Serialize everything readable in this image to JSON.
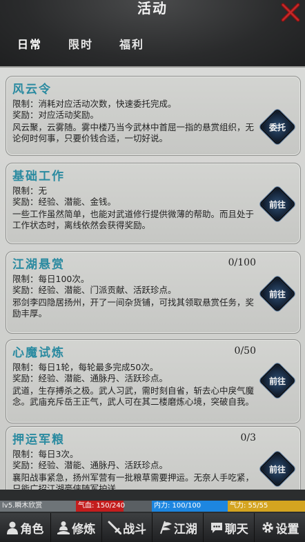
{
  "header": {
    "title": "活动",
    "tabs": [
      {
        "label": "日常",
        "active": true
      },
      {
        "label": "限时",
        "active": false
      },
      {
        "label": "福利",
        "active": false
      }
    ]
  },
  "activities": [
    {
      "title": "风云令",
      "count": "",
      "limit": "限制：消耗对应活动次数，快速委托完成。",
      "reward": "奖励：对应活动奖励。",
      "desc": "风云聚，云雾随。雾中楼乃当今武林中首屈一指的悬赏组织，无论何时何事，只要价钱合适，一切好说。",
      "button": "委托"
    },
    {
      "title": "基础工作",
      "count": "",
      "limit": "限制：无",
      "reward": "奖励：经验、潜能、金钱。",
      "desc": "一些工作虽然简单，也能对武道修行提供微薄的帮助。而且处于工作状态时，离线依然会获得奖励。",
      "button": "前往"
    },
    {
      "title": "江湖悬赏",
      "count": "0/100",
      "limit": "限制：每日100次。",
      "reward": "奖励：经验、潜能、门派贡献、活跃珍点。",
      "desc": "邪剑李四隐居扬州，开了一间杂货铺，可找其领取悬赏任务，奖励丰厚。",
      "button": "前往"
    },
    {
      "title": "心魔试炼",
      "count": "0/50",
      "limit": "限制：每日1轮，每轮最多完成50次。",
      "reward": "奖励：经验、潜能、通脉丹、活跃珍点。",
      "desc": "武道，生存搏杀之极。武人习武，需时刻自省，斩去心中戾气魔念。武庙充斥岳王正气，武人可在其二楼磨炼心境，突破自我。",
      "button": "前往"
    },
    {
      "title": "押运军粮",
      "count": "0/3",
      "limit": "限制：每日3次。",
      "reward": "奖励：经验、潜能、通脉丹、活跃珍点。",
      "desc": "襄阳战事紧急，扬州军营有一批粮草需要押运。无奈人手吃紧，只能广招江湖豪侠随军护送。",
      "button": "前往"
    }
  ],
  "status": {
    "name": "lv5.瞬木欣赏",
    "hp_label": "气血: 150/240",
    "hp_fraction": 0.625,
    "mp_label": "内力: 100/100",
    "qi_label": "气力: 55/55"
  },
  "nav": [
    {
      "label": "角色",
      "icon": "person-icon"
    },
    {
      "label": "修炼",
      "icon": "meditate-icon"
    },
    {
      "label": "战斗",
      "icon": "sword-icon"
    },
    {
      "label": "江湖",
      "icon": "flag-icon"
    },
    {
      "label": "聊天",
      "icon": "chat-icon"
    },
    {
      "label": "设置",
      "icon": "gear-icon"
    }
  ]
}
